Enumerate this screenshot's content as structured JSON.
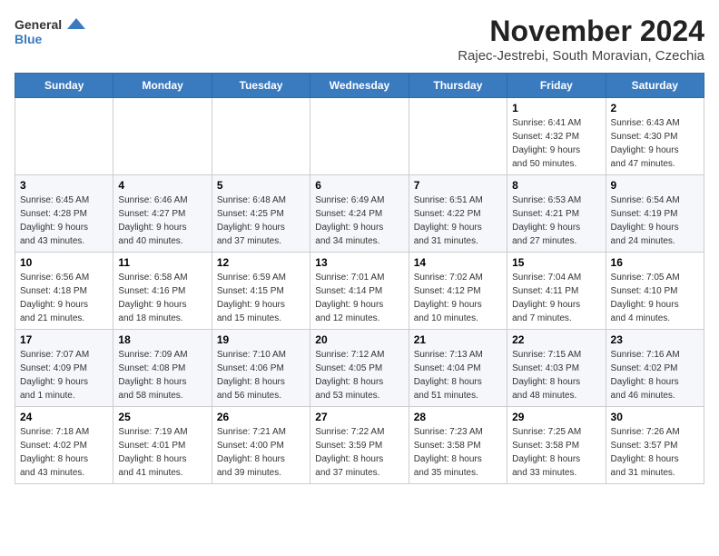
{
  "header": {
    "logo_line1": "General",
    "logo_line2": "Blue",
    "month": "November 2024",
    "location": "Rajec-Jestrebi, South Moravian, Czechia"
  },
  "weekdays": [
    "Sunday",
    "Monday",
    "Tuesday",
    "Wednesday",
    "Thursday",
    "Friday",
    "Saturday"
  ],
  "weeks": [
    [
      {
        "day": "",
        "info": ""
      },
      {
        "day": "",
        "info": ""
      },
      {
        "day": "",
        "info": ""
      },
      {
        "day": "",
        "info": ""
      },
      {
        "day": "",
        "info": ""
      },
      {
        "day": "1",
        "info": "Sunrise: 6:41 AM\nSunset: 4:32 PM\nDaylight: 9 hours\nand 50 minutes."
      },
      {
        "day": "2",
        "info": "Sunrise: 6:43 AM\nSunset: 4:30 PM\nDaylight: 9 hours\nand 47 minutes."
      }
    ],
    [
      {
        "day": "3",
        "info": "Sunrise: 6:45 AM\nSunset: 4:28 PM\nDaylight: 9 hours\nand 43 minutes."
      },
      {
        "day": "4",
        "info": "Sunrise: 6:46 AM\nSunset: 4:27 PM\nDaylight: 9 hours\nand 40 minutes."
      },
      {
        "day": "5",
        "info": "Sunrise: 6:48 AM\nSunset: 4:25 PM\nDaylight: 9 hours\nand 37 minutes."
      },
      {
        "day": "6",
        "info": "Sunrise: 6:49 AM\nSunset: 4:24 PM\nDaylight: 9 hours\nand 34 minutes."
      },
      {
        "day": "7",
        "info": "Sunrise: 6:51 AM\nSunset: 4:22 PM\nDaylight: 9 hours\nand 31 minutes."
      },
      {
        "day": "8",
        "info": "Sunrise: 6:53 AM\nSunset: 4:21 PM\nDaylight: 9 hours\nand 27 minutes."
      },
      {
        "day": "9",
        "info": "Sunrise: 6:54 AM\nSunset: 4:19 PM\nDaylight: 9 hours\nand 24 minutes."
      }
    ],
    [
      {
        "day": "10",
        "info": "Sunrise: 6:56 AM\nSunset: 4:18 PM\nDaylight: 9 hours\nand 21 minutes."
      },
      {
        "day": "11",
        "info": "Sunrise: 6:58 AM\nSunset: 4:16 PM\nDaylight: 9 hours\nand 18 minutes."
      },
      {
        "day": "12",
        "info": "Sunrise: 6:59 AM\nSunset: 4:15 PM\nDaylight: 9 hours\nand 15 minutes."
      },
      {
        "day": "13",
        "info": "Sunrise: 7:01 AM\nSunset: 4:14 PM\nDaylight: 9 hours\nand 12 minutes."
      },
      {
        "day": "14",
        "info": "Sunrise: 7:02 AM\nSunset: 4:12 PM\nDaylight: 9 hours\nand 10 minutes."
      },
      {
        "day": "15",
        "info": "Sunrise: 7:04 AM\nSunset: 4:11 PM\nDaylight: 9 hours\nand 7 minutes."
      },
      {
        "day": "16",
        "info": "Sunrise: 7:05 AM\nSunset: 4:10 PM\nDaylight: 9 hours\nand 4 minutes."
      }
    ],
    [
      {
        "day": "17",
        "info": "Sunrise: 7:07 AM\nSunset: 4:09 PM\nDaylight: 9 hours\nand 1 minute."
      },
      {
        "day": "18",
        "info": "Sunrise: 7:09 AM\nSunset: 4:08 PM\nDaylight: 8 hours\nand 58 minutes."
      },
      {
        "day": "19",
        "info": "Sunrise: 7:10 AM\nSunset: 4:06 PM\nDaylight: 8 hours\nand 56 minutes."
      },
      {
        "day": "20",
        "info": "Sunrise: 7:12 AM\nSunset: 4:05 PM\nDaylight: 8 hours\nand 53 minutes."
      },
      {
        "day": "21",
        "info": "Sunrise: 7:13 AM\nSunset: 4:04 PM\nDaylight: 8 hours\nand 51 minutes."
      },
      {
        "day": "22",
        "info": "Sunrise: 7:15 AM\nSunset: 4:03 PM\nDaylight: 8 hours\nand 48 minutes."
      },
      {
        "day": "23",
        "info": "Sunrise: 7:16 AM\nSunset: 4:02 PM\nDaylight: 8 hours\nand 46 minutes."
      }
    ],
    [
      {
        "day": "24",
        "info": "Sunrise: 7:18 AM\nSunset: 4:02 PM\nDaylight: 8 hours\nand 43 minutes."
      },
      {
        "day": "25",
        "info": "Sunrise: 7:19 AM\nSunset: 4:01 PM\nDaylight: 8 hours\nand 41 minutes."
      },
      {
        "day": "26",
        "info": "Sunrise: 7:21 AM\nSunset: 4:00 PM\nDaylight: 8 hours\nand 39 minutes."
      },
      {
        "day": "27",
        "info": "Sunrise: 7:22 AM\nSunset: 3:59 PM\nDaylight: 8 hours\nand 37 minutes."
      },
      {
        "day": "28",
        "info": "Sunrise: 7:23 AM\nSunset: 3:58 PM\nDaylight: 8 hours\nand 35 minutes."
      },
      {
        "day": "29",
        "info": "Sunrise: 7:25 AM\nSunset: 3:58 PM\nDaylight: 8 hours\nand 33 minutes."
      },
      {
        "day": "30",
        "info": "Sunrise: 7:26 AM\nSunset: 3:57 PM\nDaylight: 8 hours\nand 31 minutes."
      }
    ]
  ]
}
